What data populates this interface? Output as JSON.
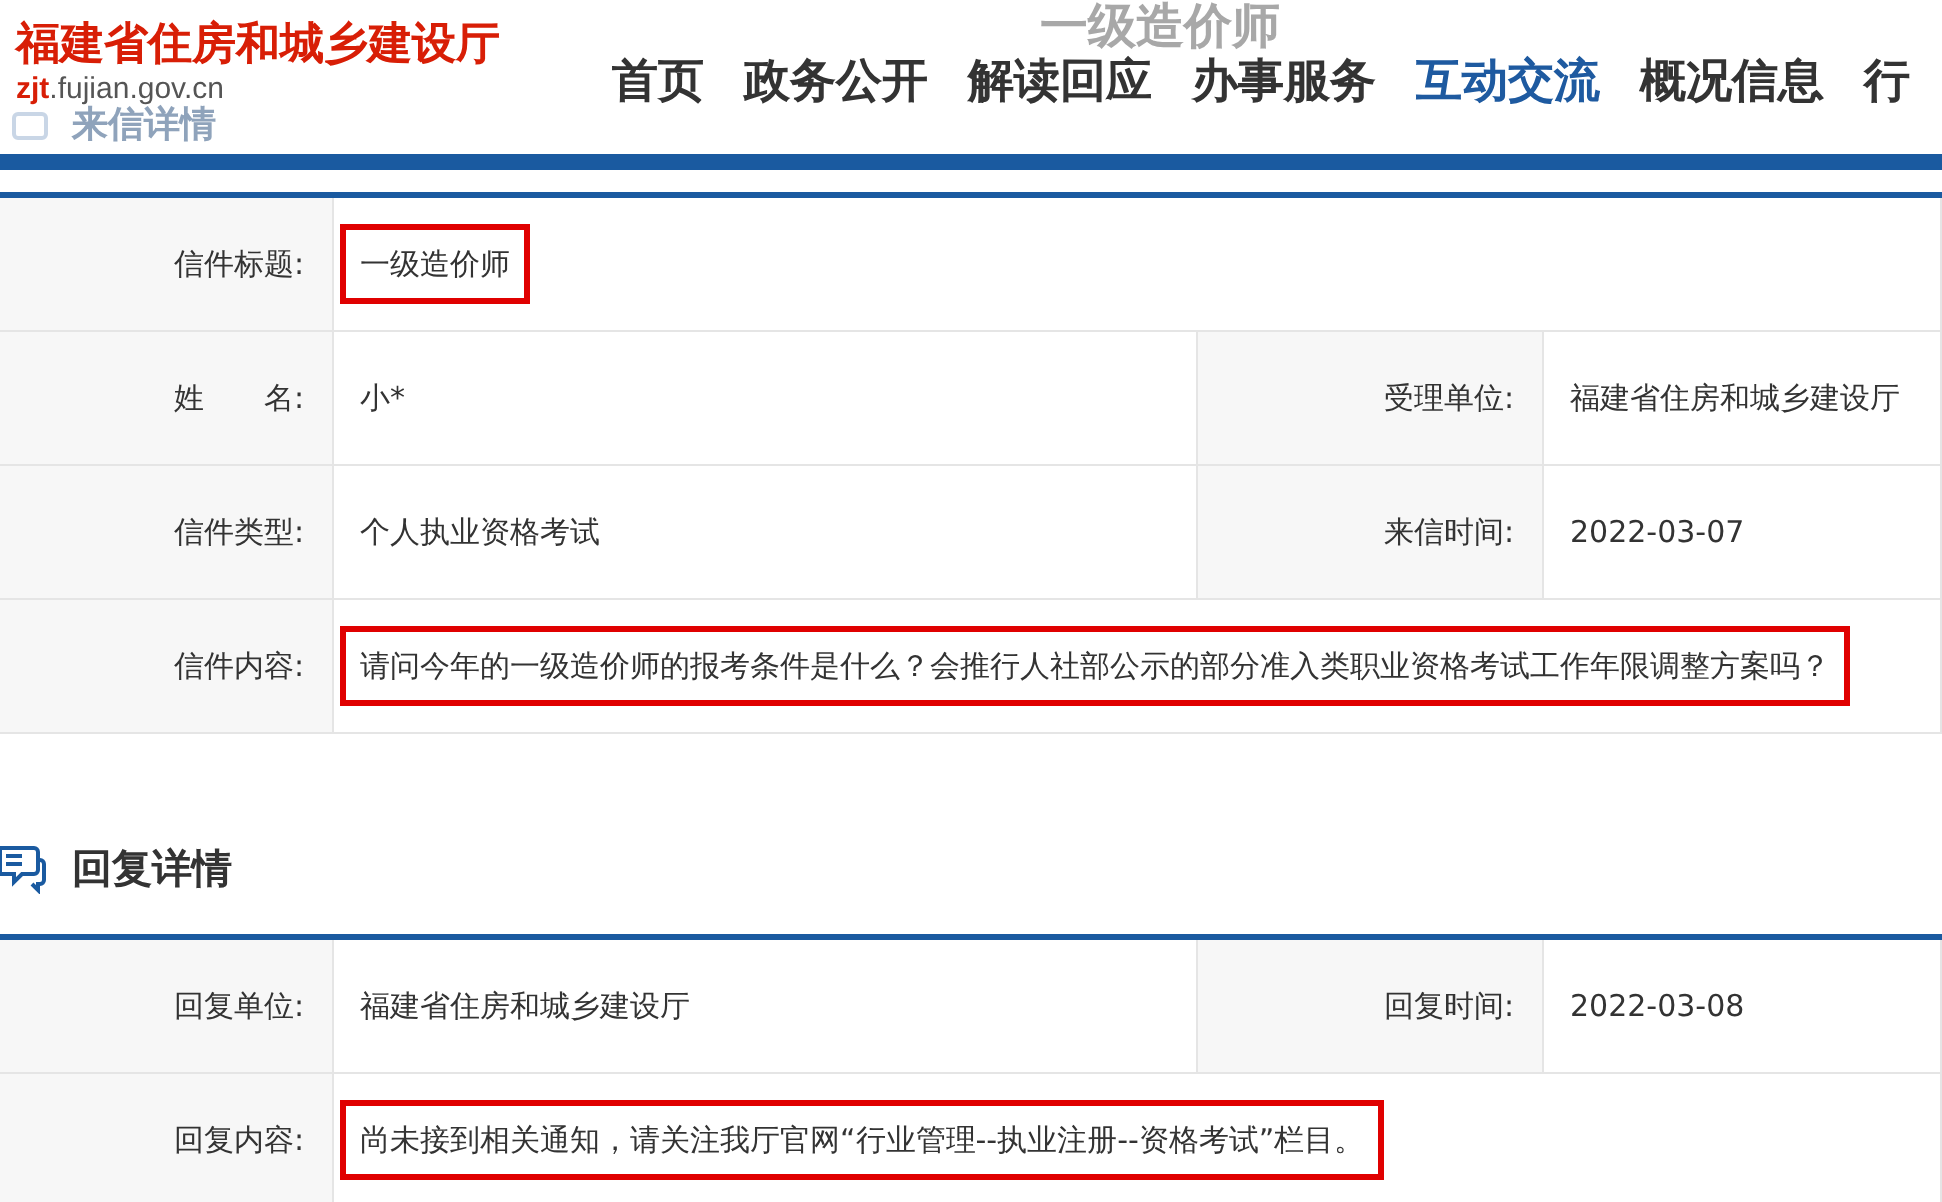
{
  "header": {
    "site_name": "福建省住房和城乡建设厅",
    "domain_prefix": "zjt",
    "domain_rest": ".fujian.gov.cn",
    "faded_title": "一级造价师",
    "faded_section": "来信详情",
    "nav": [
      {
        "label": "首页",
        "selected": false
      },
      {
        "label": "政务公开",
        "selected": false
      },
      {
        "label": "解读回应",
        "selected": false
      },
      {
        "label": "办事服务",
        "selected": false
      },
      {
        "label": "互动交流",
        "selected": true
      },
      {
        "label": "概况信息",
        "selected": false
      },
      {
        "label": "行",
        "selected": false
      }
    ]
  },
  "letter": {
    "rows": [
      {
        "cells": [
          {
            "label": "信件标题:",
            "value": "一级造价师",
            "highlighted": true
          }
        ]
      },
      {
        "cells": [
          {
            "label": "姓　　名:",
            "value": "小*",
            "highlighted": false
          },
          {
            "label": "受理单位:",
            "value": "福建省住房和城乡建设厅",
            "highlighted": false
          }
        ]
      },
      {
        "cells": [
          {
            "label": "信件类型:",
            "value": "个人执业资格考试",
            "highlighted": false
          },
          {
            "label": "来信时间:",
            "value": "2022-03-07",
            "highlighted": false
          }
        ]
      },
      {
        "cells": [
          {
            "label": "信件内容:",
            "value": "请问今年的一级造价师的报考条件是什么？会推行人社部公示的部分准入类职业资格考试工作年限调整方案吗？",
            "highlighted": true
          }
        ]
      }
    ]
  },
  "reply": {
    "heading": "回复详情",
    "rows": [
      {
        "cells": [
          {
            "label": "回复单位:",
            "value": "福建省住房和城乡建设厅",
            "highlighted": false
          },
          {
            "label": "回复时间:",
            "value": "2022-03-08",
            "highlighted": false
          }
        ]
      },
      {
        "cells": [
          {
            "label": "回复内容:",
            "value": "尚未接到相关通知，请关注我厅官网“行业管理--执业注册--资格考试”栏目。",
            "highlighted": true
          }
        ]
      }
    ]
  }
}
